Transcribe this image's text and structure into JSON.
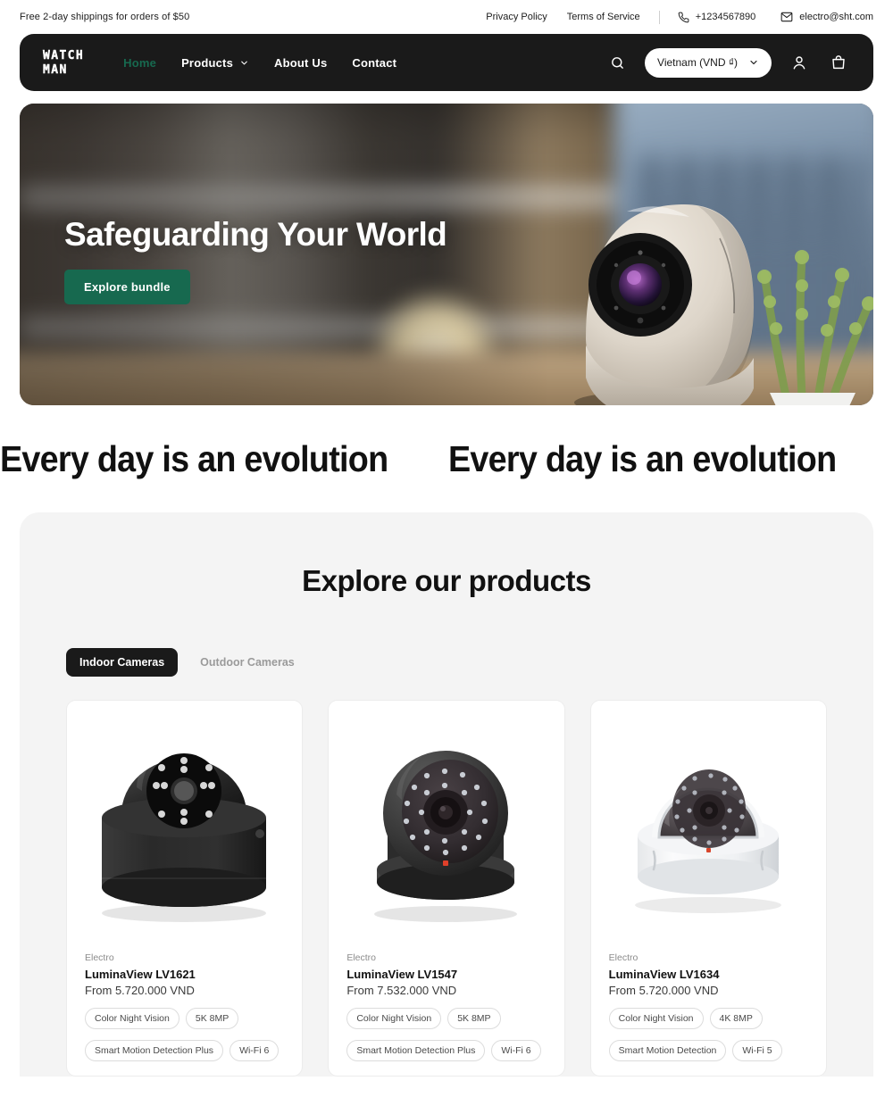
{
  "announcement": {
    "message": "Free 2-day shippings for orders of $50",
    "links": [
      {
        "label": "Privacy Policy"
      },
      {
        "label": "Terms of Service"
      }
    ],
    "phone": "+1234567890",
    "email": "electro@sht.com"
  },
  "header": {
    "logo_line1": "WATCH",
    "logo_line2": "MAN",
    "nav": [
      {
        "label": "Home",
        "active": true,
        "has_caret": false
      },
      {
        "label": "Products",
        "active": false,
        "has_caret": true
      },
      {
        "label": "About Us",
        "active": false,
        "has_caret": false
      },
      {
        "label": "Contact",
        "active": false,
        "has_caret": false
      }
    ],
    "currency_selected": "Vietnam (VND ₫)",
    "accent_color": "#17694f",
    "bar_color": "#1a1a1a"
  },
  "hero": {
    "title": "Safeguarding Your World",
    "cta_label": "Explore bundle",
    "cta_color": "#17694f"
  },
  "marquee": {
    "text": "Every day is an evolution",
    "repeat": 3
  },
  "products": {
    "heading": "Explore our products",
    "tabs": [
      {
        "label": "Indoor Cameras",
        "active": true
      },
      {
        "label": "Outdoor Cameras",
        "active": false
      }
    ],
    "items": [
      {
        "vendor": "Electro",
        "name": "LuminaView LV1621",
        "price": "From 5.720.000 VND",
        "chips": [
          "Color Night Vision",
          "5K 8MP",
          "Smart Motion Detection Plus",
          "Wi-Fi 6"
        ]
      },
      {
        "vendor": "Electro",
        "name": "LuminaView LV1547",
        "price": "From 7.532.000 VND",
        "chips": [
          "Color Night Vision",
          "5K 8MP",
          "Smart Motion Detection Plus",
          "Wi-Fi 6"
        ]
      },
      {
        "vendor": "Electro",
        "name": "LuminaView LV1634",
        "price": "From 5.720.000 VND",
        "chips": [
          "Color Night Vision",
          "4K 8MP",
          "Smart Motion Detection",
          "Wi-Fi 5"
        ]
      }
    ]
  }
}
